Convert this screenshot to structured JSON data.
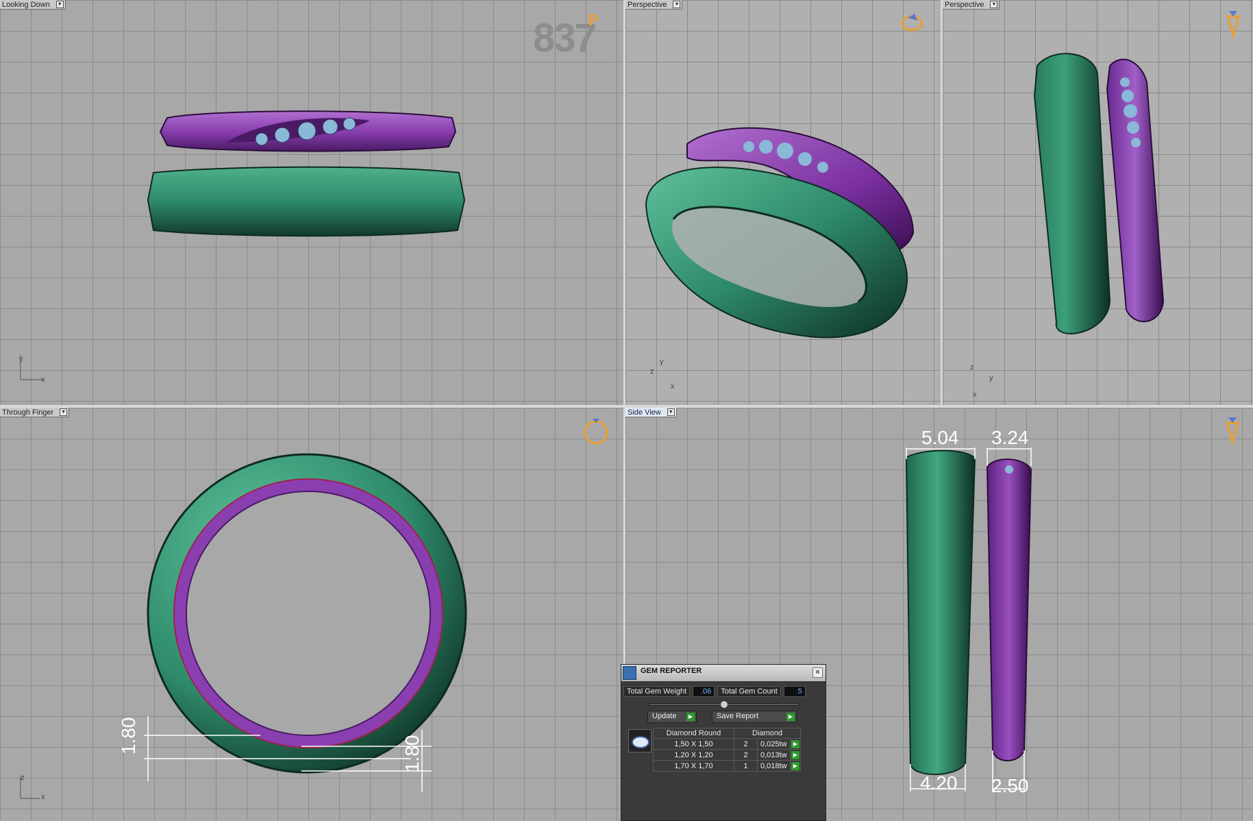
{
  "viewports": {
    "top_left": {
      "label": "Looking Down",
      "axis_y": "y",
      "axis_x": "x"
    },
    "top_mid": {
      "label": "Perspective",
      "axis_y": "y",
      "axis_x": "x",
      "axis_z": "z"
    },
    "top_right": {
      "label": "Perspective",
      "axis_y": "y",
      "axis_x": "x",
      "axis_z": "z"
    },
    "bottom_left": {
      "label": "Through Finger",
      "axis_y": "z",
      "axis_x": "x"
    },
    "bottom_right": {
      "label": "Side View"
    }
  },
  "watermark": {
    "text": "837",
    "sup": "P"
  },
  "dimensions": {
    "side_top_left": "5.04",
    "side_top_right": "3.24",
    "side_bottom_left": "4.20",
    "side_bottom_right": "2.50",
    "finger_left": "1.80",
    "finger_right": "1.80"
  },
  "gem_reporter": {
    "title": "GEM REPORTER",
    "close": "×",
    "total_weight_label": "Total Gem Weight",
    "total_weight_value": ".06",
    "total_count_label": "Total Gem Count",
    "total_count_value": "5",
    "update_label": "Update",
    "save_label": "Save Report",
    "arrow": "▶",
    "table_headers": [
      "Diamond Round",
      "Diamond"
    ],
    "rows": [
      {
        "size": "1,50 X 1,50",
        "count": "2",
        "weight": "0,025tw"
      },
      {
        "size": "1,20 X 1,20",
        "count": "2",
        "weight": "0,013tw"
      },
      {
        "size": "1,70 X 1,70",
        "count": "1",
        "weight": "0,018tw"
      }
    ]
  },
  "colors": {
    "green_ring": "#2e8a6a",
    "purple_ring": "#8a3fb0",
    "gem": "#8ab8d8",
    "nav_orange": "#e8a030",
    "nav_blue": "#5a78c8"
  }
}
